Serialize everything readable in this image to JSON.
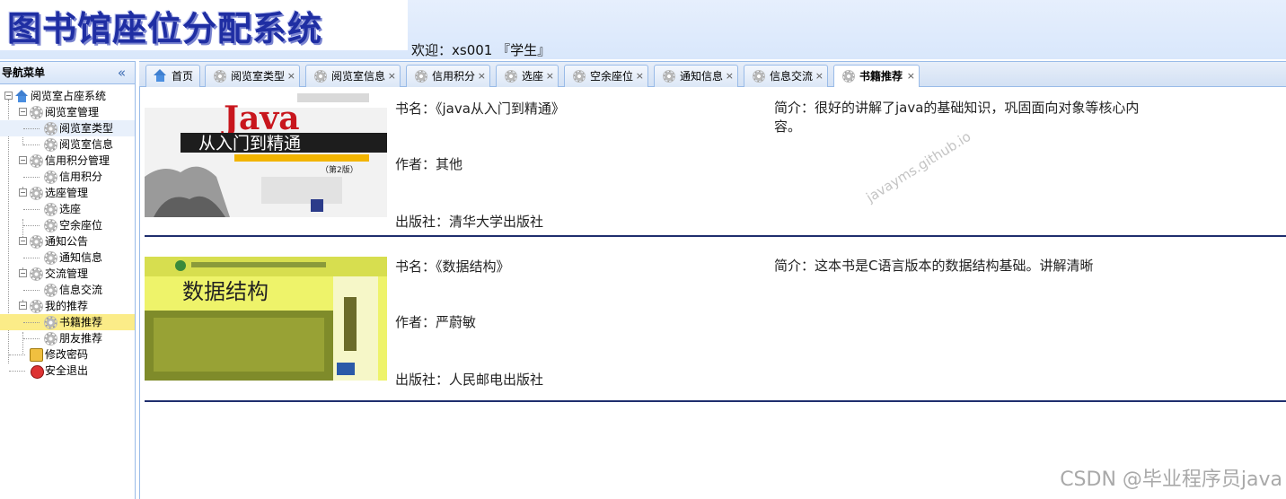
{
  "header": {
    "logo_text": "图书馆座位分配系统",
    "welcome": "欢迎：xs001 『学生』"
  },
  "sidebar": {
    "title": "导航菜单",
    "collapse": "«",
    "tree": {
      "root": "阅览室占座系统",
      "items": [
        {
          "label": "阅览室管理",
          "children": [
            "阅览室类型",
            "阅览室信息"
          ]
        },
        {
          "label": "信用积分管理",
          "children": [
            "信用积分"
          ]
        },
        {
          "label": "选座管理",
          "children": [
            "选座",
            "空余座位"
          ]
        },
        {
          "label": "通知公告",
          "children": [
            "通知信息"
          ]
        },
        {
          "label": "交流管理",
          "children": [
            "信息交流"
          ]
        },
        {
          "label": "我的推荐",
          "children": [
            "书籍推荐",
            "朋友推荐"
          ]
        }
      ],
      "change_password": "修改密码",
      "logout": "安全退出"
    }
  },
  "tabs": [
    {
      "label": "首页",
      "icon": "home-icon",
      "closable": false
    },
    {
      "label": "阅览室类型",
      "icon": "gear-icon",
      "closable": true
    },
    {
      "label": "阅览室信息",
      "icon": "gear-icon",
      "closable": true
    },
    {
      "label": "信用积分",
      "icon": "gear-icon",
      "closable": true
    },
    {
      "label": "选座",
      "icon": "gear-icon",
      "closable": true
    },
    {
      "label": "空余座位",
      "icon": "gear-icon",
      "closable": true
    },
    {
      "label": "通知信息",
      "icon": "gear-icon",
      "closable": true
    },
    {
      "label": "信息交流",
      "icon": "gear-icon",
      "closable": true
    },
    {
      "label": "书籍推荐",
      "icon": "gear-icon",
      "closable": true,
      "active": true
    }
  ],
  "tab_close": "×",
  "books": [
    {
      "title": "书名：《java从入门到精通》",
      "author": "作者：其他",
      "publisher": "出版社：清华大学出版社",
      "intro": "简介：很好的讲解了java的基础知识，巩固面向对象等核心内容。",
      "cover_title": "Java",
      "cover_subtitle": "从入门到精通",
      "cover_edition": "（第2版）"
    },
    {
      "title": "书名：《数据结构》",
      "author": "作者：严蔚敏",
      "publisher": "出版社：人民邮电出版社",
      "intro": "简介：这本书是C语言版本的数据结构基础。讲解清晰",
      "cover_title": "数据结构"
    }
  ],
  "watermarks": {
    "content": "javayms.github.io",
    "csdn": "CSDN @毕业程序员java"
  }
}
